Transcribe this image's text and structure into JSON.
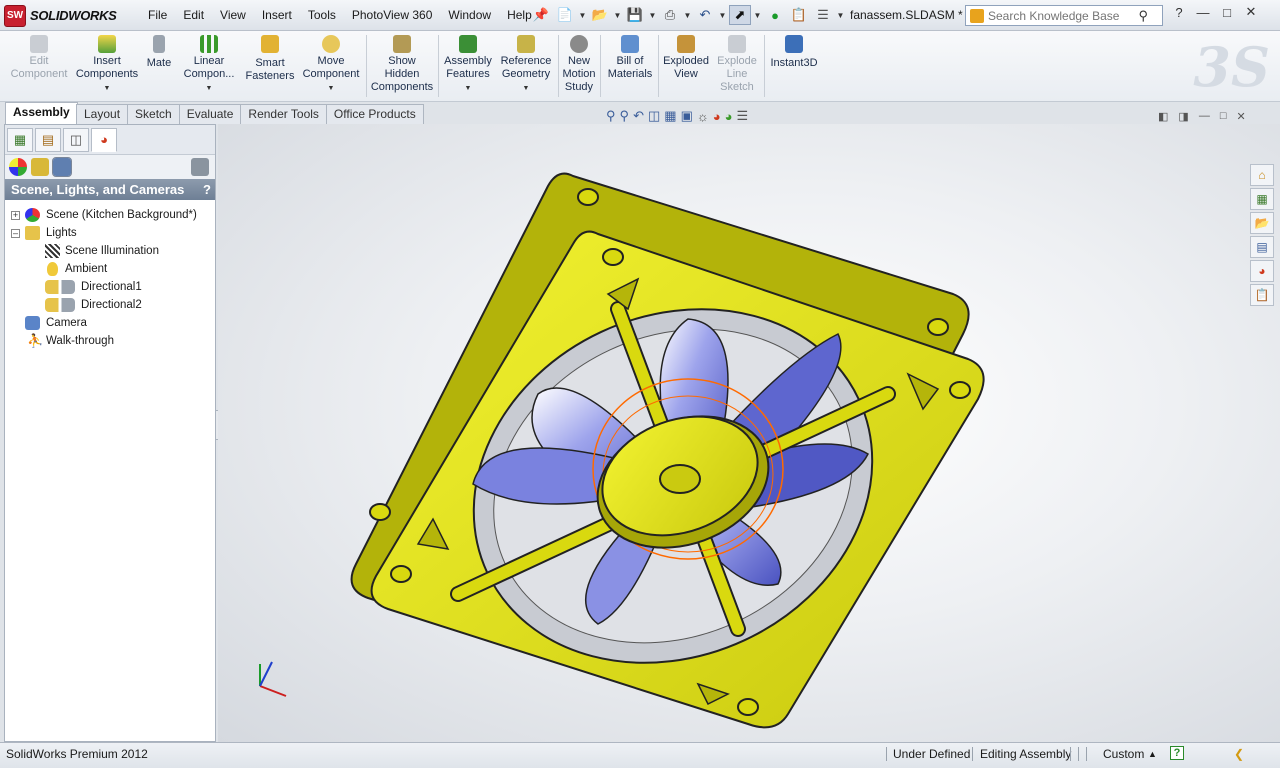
{
  "app": {
    "logo_badge": "SW",
    "logo_text": "SOLIDWORKS",
    "file_name": "fanassem.SLDASM *"
  },
  "menus": [
    "File",
    "Edit",
    "View",
    "Insert",
    "Tools",
    "PhotoView 360",
    "Window",
    "Help"
  ],
  "search": {
    "placeholder": "Search Knowledge Base"
  },
  "toolbar": {
    "edit_component": "Edit\nComponent",
    "insert_components": "Insert\nComponents",
    "mate": "Mate",
    "linear_component": "Linear\nCompon...",
    "smart_fasteners": "Smart\nFasteners",
    "move_component": "Move\nComponent",
    "show_hidden": "Show\nHidden\nComponents",
    "assembly_features": "Assembly\nFeatures",
    "reference_geometry": "Reference\nGeometry",
    "new_motion_study": "New\nMotion\nStudy",
    "bill_of_materials": "Bill of\nMaterials",
    "exploded_view": "Exploded\nView",
    "explode_line_sketch": "Explode\nLine\nSketch",
    "instant3d": "Instant3D"
  },
  "tabs": [
    "Assembly",
    "Layout",
    "Sketch",
    "Evaluate",
    "Render Tools",
    "Office Products"
  ],
  "panel": {
    "title": "Scene, Lights, and Cameras",
    "help": "?",
    "tree": {
      "scene": "Scene (Kitchen Background*)",
      "lights": "Lights",
      "scene_illumination": "Scene Illumination",
      "ambient": "Ambient",
      "directional1": "Directional1",
      "directional2": "Directional2",
      "camera": "Camera",
      "walkthrough": "Walk-through"
    }
  },
  "status": {
    "product": "SolidWorks Premium 2012",
    "state": "Under Defined",
    "mode": "Editing Assembly",
    "units": "Custom",
    "help": "?"
  },
  "colors": {
    "frame_yellow": "#e8e81a",
    "blade_blue": "#6c74d8",
    "highlight_orange": "#ff6a00"
  }
}
